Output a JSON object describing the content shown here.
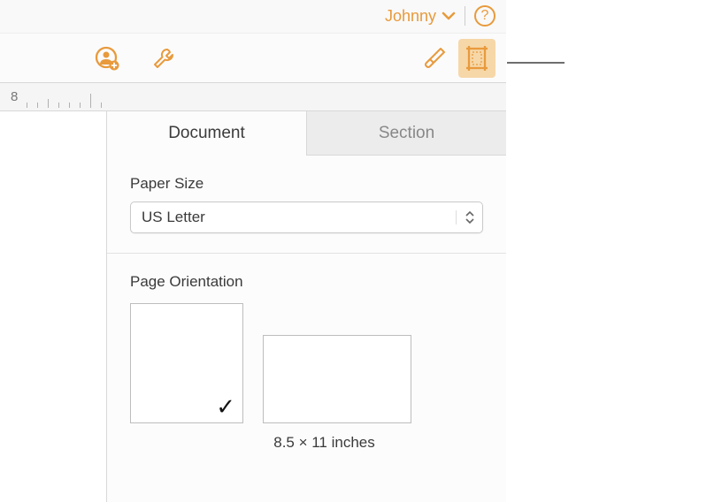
{
  "header": {
    "user_name": "Johnny"
  },
  "ruler": {
    "number": "8"
  },
  "inspector": {
    "tabs": {
      "document": "Document",
      "section": "Section"
    },
    "paper_size": {
      "label": "Paper Size",
      "value": "US Letter"
    },
    "orientation": {
      "label": "Page Orientation",
      "dimensions": "8.5 × 11 inches"
    }
  },
  "icons": {
    "collaborate": "collaborate",
    "tools": "tools",
    "format": "format",
    "document": "document"
  },
  "colors": {
    "accent": "#e89a3c"
  }
}
